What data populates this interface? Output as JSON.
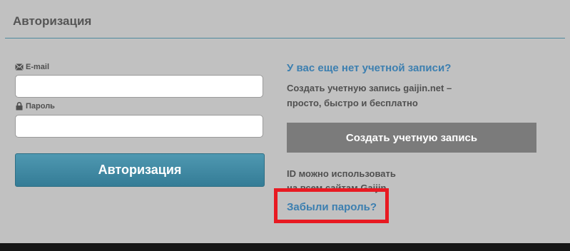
{
  "panel": {
    "title": "Авторизация"
  },
  "login_form": {
    "email_label": "E-mail",
    "email_icon": "envelope-icon",
    "email_value": "",
    "password_label": "Пароль",
    "password_icon": "lock-icon",
    "password_value": "",
    "submit_label": "Авторизация"
  },
  "register": {
    "heading": "У вас еще нет учетной записи?",
    "description_lines": [
      "Создать учетную запись gaijin.net –",
      "просто, быстро и бесплатно"
    ],
    "button_label": "Создать учетную запись"
  },
  "id_note_lines": [
    "ID можно использовать",
    "на всем сайтам Gaijin"
  ],
  "forgot_password": "Забыли пароль?",
  "colors": {
    "background": "#c1c1c1",
    "accent_link": "#3c7fb0",
    "login_button": "#3f8aa4",
    "register_button": "#7b7b7b",
    "highlight": "#e81a22",
    "header_rule": "#4f8a9e"
  }
}
